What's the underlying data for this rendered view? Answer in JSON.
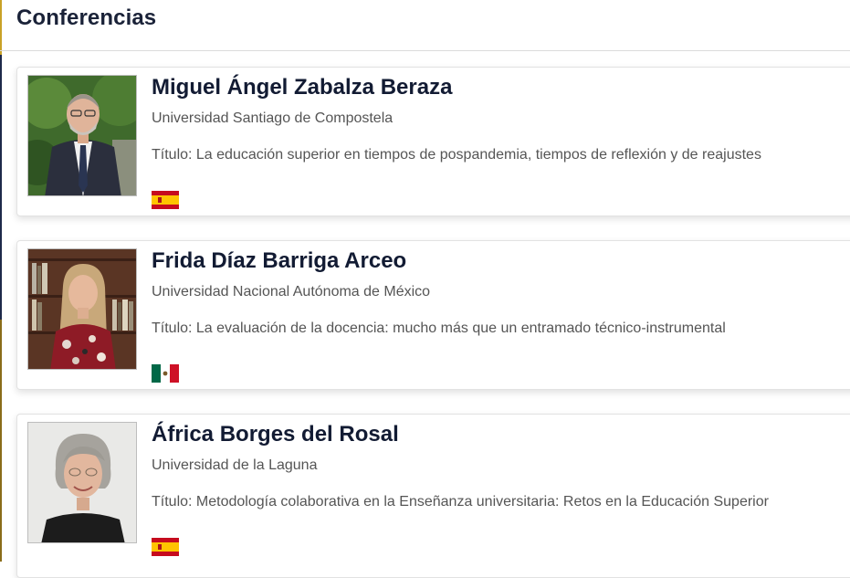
{
  "section": {
    "title": "Conferencias"
  },
  "speakers": [
    {
      "name": "Miguel Ángel Zabalza Beraza",
      "affiliation": "Universidad Santiago de Compostela",
      "talk": "Título: La educación superior en tiempos de pospandemia, tiempos de reflexión y de reajustes",
      "country_flag": "spain-flag-icon"
    },
    {
      "name": "Frida Díaz Barriga Arceo",
      "affiliation": "Universidad Nacional Autónoma de México",
      "talk": "Título: La evaluación de la docencia: mucho más que un entramado técnico-instrumental",
      "country_flag": "mexico-flag-icon"
    },
    {
      "name": "África Borges del Rosal",
      "affiliation": "Universidad de la Laguna",
      "talk": "Título: Metodología colaborativa en la Enseñanza universitaria: Retos en la Educación Superior",
      "country_flag": "spain-flag-icon"
    }
  ],
  "colors": {
    "title_text": "#121b33",
    "secondary_text": "#555555",
    "card_border": "#e2e2e2",
    "spain_red": "#c60b1e",
    "spain_yellow": "#ffc400",
    "mexico_green": "#006847",
    "mexico_red": "#ce1126"
  }
}
